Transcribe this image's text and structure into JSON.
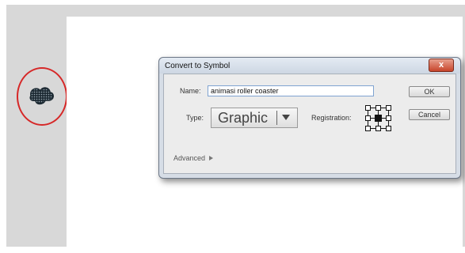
{
  "dialog": {
    "title": "Convert to Symbol",
    "close_label": "x",
    "name_label": "Name:",
    "name_value": "animasi roller coaster",
    "type_label": "Type:",
    "type_value": "Graphic",
    "registration_label": "Registration:",
    "ok_label": "OK",
    "cancel_label": "Cancel",
    "advanced_label": "Advanced"
  },
  "colors": {
    "highlight_circle": "#d62828",
    "close_button": "#c7442a",
    "name_field_border": "#7fa3d1"
  },
  "icons": {
    "selected_object": "roller-coaster-shape-icon",
    "registration": "registration-point-icon",
    "advanced": "triangle-right-icon",
    "type_dropdown": "chevron-down-icon"
  }
}
